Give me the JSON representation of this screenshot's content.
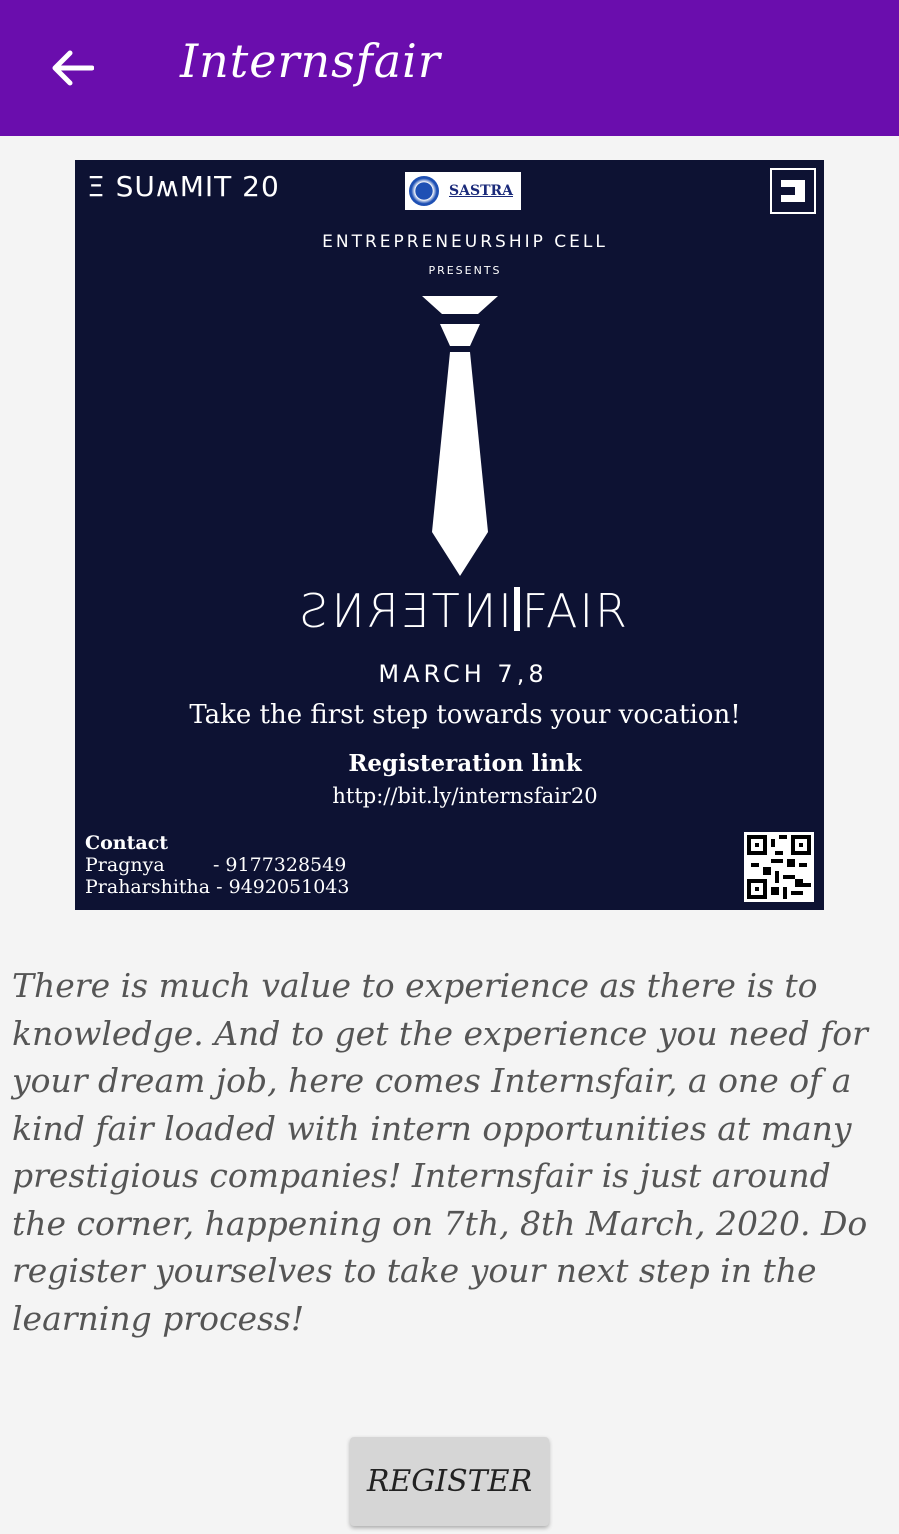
{
  "appbar": {
    "title": "Internsfair",
    "back_icon": "arrow-left-icon",
    "background": "#6a0dad"
  },
  "poster": {
    "summit_logo": "Ξ SUʍMIT 20",
    "sastra_logo": "SASTRA",
    "heading": "ENTREPRENEURSHIP CELL",
    "presents": "PRESENTS",
    "fair_title_mirrored": "INTERNS",
    "fair_title_rest": "FAIR",
    "dates": "MARCH 7,8",
    "tagline": "Take the first step towards your vocation!",
    "registration_label": "Registeration link",
    "registration_link": "http://bit.ly/internsfair20",
    "contact_label": "Contact",
    "contacts": [
      "Pragnya        - 9177328549",
      "Praharshitha - 9492051043"
    ],
    "background": "#0d1233"
  },
  "description": "There is much value to experience as there is to knowledge. And to get the experience you need for your dream job, here comes Internsfair, a one of a kind fair loaded with intern opportunities at many prestigious companies! Internsfair is just around the corner, happening on 7th, 8th March, 2020. Do register yourselves to take your next step in the learning process!",
  "register_button": "REGISTER"
}
